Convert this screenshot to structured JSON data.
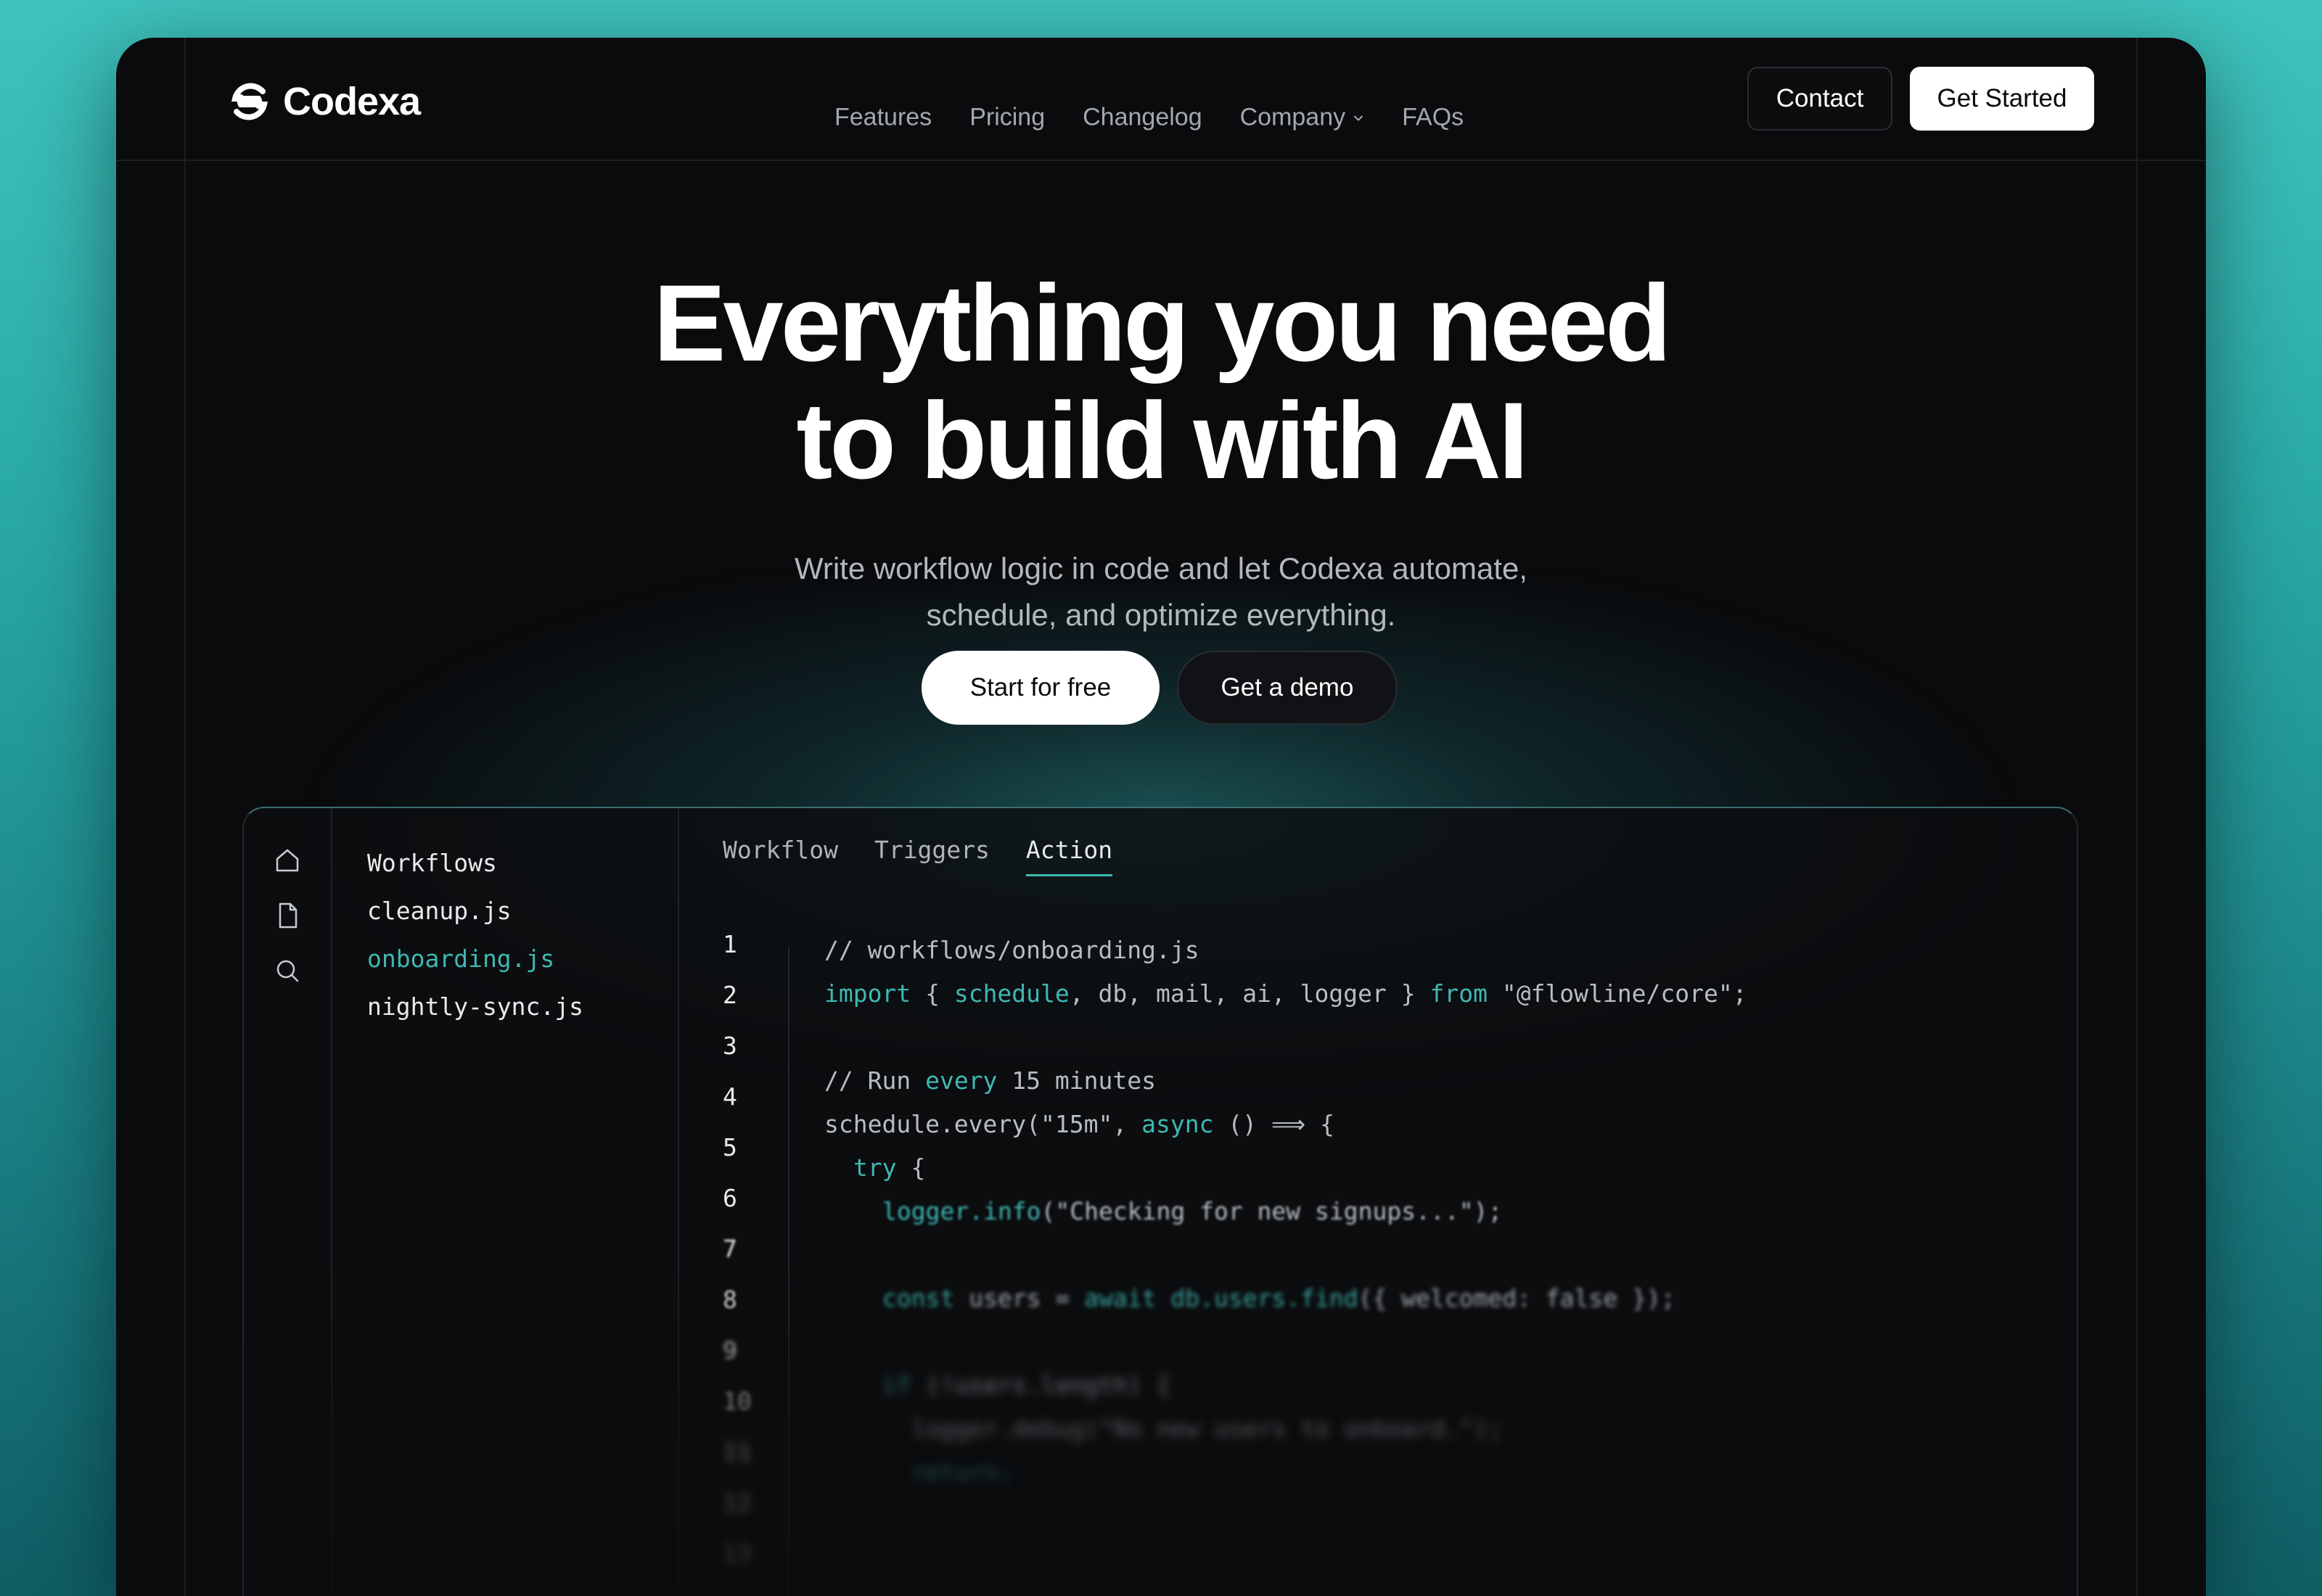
{
  "brand": {
    "name": "Codexa"
  },
  "nav": {
    "links": [
      "Features",
      "Pricing",
      "Changelog",
      "Company",
      "FAQs"
    ],
    "contact_label": "Contact",
    "get_started_label": "Get Started"
  },
  "hero": {
    "title_line1": "Everything you need",
    "title_line2": "to build with AI",
    "subtitle_line1": "Write workflow logic in code and let Codexa automate,",
    "subtitle_line2": "schedule, and optimize everything.",
    "primary_cta": "Start for free",
    "secondary_cta": "Get a demo"
  },
  "editor": {
    "sidebar_icons": [
      "home-icon",
      "file-icon",
      "search-icon"
    ],
    "files": [
      "Workflows",
      "cleanup.js",
      "onboarding.js",
      "nightly-sync.js"
    ],
    "active_file": "onboarding.js",
    "tabs": [
      "Workflow",
      "Triggers",
      "Action"
    ],
    "active_tab": "Action",
    "line_numbers": [
      "1",
      "2",
      "3",
      "4",
      "5",
      "6",
      "7",
      "8",
      "9",
      "10",
      "11",
      "12",
      "13"
    ],
    "code": {
      "l1": "// workflows/onboarding.js",
      "l2_kw1": "import",
      "l2_a": " { ",
      "l2_kw2": "schedule",
      "l2_b": ", db, mail, ai, logger } ",
      "l2_kw3": "from",
      "l2_c": " \"@flowline/core\";",
      "l4_a": "// Run ",
      "l4_kw": "every",
      "l4_b": " 15 minutes",
      "l5_a": "schedule.every(\"15m\", ",
      "l5_kw": "async",
      "l5_b": " () ⟹ {",
      "l6_kw": "try",
      "l6_b": " {",
      "l7_kw": "logger.info",
      "l7_b": "(\"Checking for new signups...\");",
      "l9_kw1": "const",
      "l9_a": " users = ",
      "l9_kw2": "await db.users.find",
      "l9_b": "({ welcomed: false });",
      "l11_kw": "if",
      "l11_b": " (!users.length) {",
      "l12": "logger.debug(\"No new users to onboard.\");",
      "l13_kw": "return;"
    }
  },
  "colors": {
    "accent": "#3fb8b3",
    "background_teal": "#2aa7a4",
    "frame_bg": "#0a0b0d"
  }
}
